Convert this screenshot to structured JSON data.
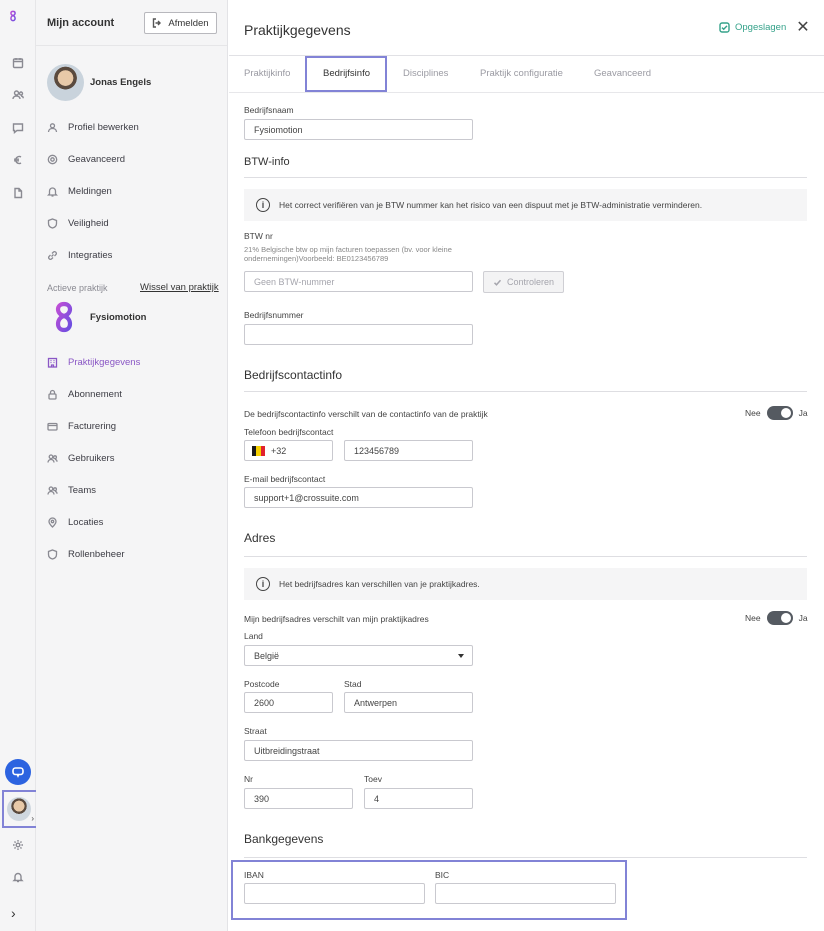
{
  "sidebar": {
    "title": "Mijn account",
    "logout_label": "Afmelden",
    "user_name": "Jonas Engels",
    "account_items": [
      {
        "label": "Profiel bewerken",
        "icon": "user-icon"
      },
      {
        "label": "Geavanceerd",
        "icon": "gear-icon"
      },
      {
        "label": "Meldingen",
        "icon": "bell-icon"
      },
      {
        "label": "Veiligheid",
        "icon": "shield-icon"
      },
      {
        "label": "Integraties",
        "icon": "link-icon"
      }
    ],
    "active_practice_label": "Actieve praktijk",
    "switch_practice_label": "Wissel van praktijk",
    "practice_name": "Fysiomotion",
    "practice_items": [
      {
        "label": "Praktijkgegevens",
        "icon": "building-icon",
        "active": true
      },
      {
        "label": "Abonnement",
        "icon": "lock-icon"
      },
      {
        "label": "Facturering",
        "icon": "card-icon"
      },
      {
        "label": "Gebruikers",
        "icon": "users-icon"
      },
      {
        "label": "Teams",
        "icon": "team-icon"
      },
      {
        "label": "Locaties",
        "icon": "pin-icon"
      },
      {
        "label": "Rollenbeheer",
        "icon": "shield-icon"
      }
    ]
  },
  "header": {
    "title": "Praktijkgegevens",
    "saved_label": "Opgeslagen",
    "tabs": [
      {
        "label": "Praktijkinfo"
      },
      {
        "label": "Bedrijfsinfo",
        "active": true
      },
      {
        "label": "Disciplines"
      },
      {
        "label": "Praktijk configuratie"
      },
      {
        "label": "Geavanceerd"
      }
    ]
  },
  "form": {
    "company_name_label": "Bedrijfsnaam",
    "company_name_value": "Fysiomotion",
    "vat_section_title": "BTW-info",
    "vat_info_text": "Het correct verifiëren van je BTW nummer kan het risico van een dispuut met je BTW-administratie verminderen.",
    "vat_label": "BTW nr",
    "vat_note": "21% Belgische btw op mijn facturen toepassen (bv. voor kleine ondernemingen)Voorbeeld: BE0123456789",
    "vat_placeholder": "Geen BTW-nummer",
    "check_button_label": "Controleren",
    "company_number_label": "Bedrijfsnummer",
    "company_number_value": "",
    "contact_section_title": "Bedrijfscontactinfo",
    "contact_differs_label": "De bedrijfscontactinfo verschilt van de contactinfo van de praktijk",
    "toggle_no": "Nee",
    "toggle_yes": "Ja",
    "phone_label": "Telefoon bedrijfscontact",
    "phone_prefix": "+32",
    "phone_value": "123456789",
    "email_label": "E-mail bedrijfscontact",
    "email_value": "support+1@crossuite.com",
    "address_section_title": "Adres",
    "address_info_text": "Het bedrijfsadres kan verschillen van je praktijkadres.",
    "address_differs_label": "Mijn bedrijfsadres verschilt van mijn praktijkadres",
    "country_label": "Land",
    "country_value": "België",
    "postcode_label": "Postcode",
    "postcode_value": "2600",
    "city_label": "Stad",
    "city_value": "Antwerpen",
    "street_label": "Straat",
    "street_value": "Uitbreidingstraat",
    "nr_label": "Nr",
    "nr_value": "390",
    "box_label": "Toev",
    "box_value": "4",
    "bank_section_title": "Bankgegevens",
    "iban_label": "IBAN",
    "iban_value": "",
    "bic_label": "BIC",
    "bic_value": ""
  },
  "colors": {
    "accent": "#8a57c5",
    "saved": "#35a28a",
    "highlight": "#8283d6",
    "chat": "#2c63e0"
  }
}
